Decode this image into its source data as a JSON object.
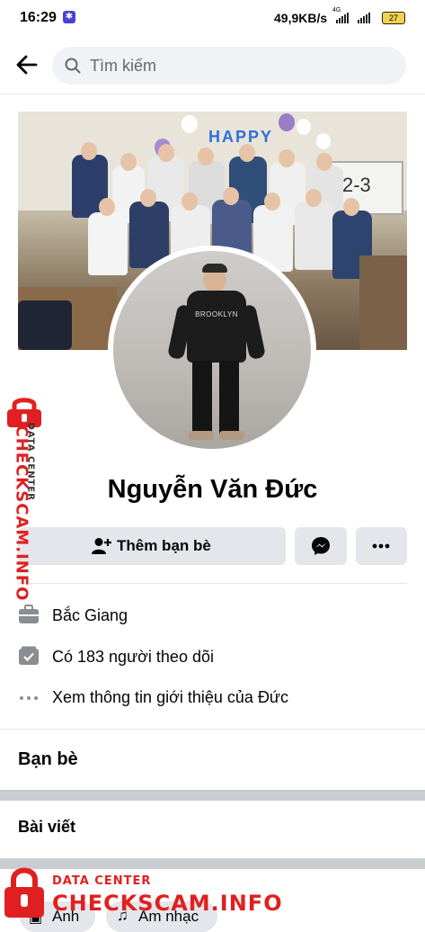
{
  "status_bar": {
    "time": "16:29",
    "net_speed": "49,9KB/s",
    "network_label": "4G",
    "battery": "27"
  },
  "header": {
    "search_placeholder": "Tìm kiếm"
  },
  "profile": {
    "name": "Nguyễn Văn Đức",
    "add_friend_label": "Thêm bạn bè",
    "info": {
      "location": "Bắc Giang",
      "followers": "Có 183 người theo dõi",
      "about": "Xem thông tin giới thiệu của Đức"
    },
    "friends_heading": "Bạn bè",
    "posts_heading": "Bài viết",
    "chips": [
      "Ảnh",
      "Âm nhạc"
    ]
  },
  "cover_photo": {
    "board_text": "2-3",
    "banner_text": "HAPPY"
  },
  "avatar_photo": {
    "shirt_text": "BROOKLYN"
  },
  "watermark": {
    "label_small": "DATA CENTER",
    "label_big": "CHECKSCAM.INFO"
  },
  "colors": {
    "accent": "#e02020",
    "button_bg": "#e4e6eb",
    "text": "#050505",
    "muted": "#65676b"
  },
  "icons": [
    "back-arrow-icon",
    "search-icon",
    "add-friend-icon",
    "messenger-icon",
    "more-icon",
    "briefcase-icon",
    "followers-icon",
    "dots-icon",
    "lock-icon"
  ]
}
